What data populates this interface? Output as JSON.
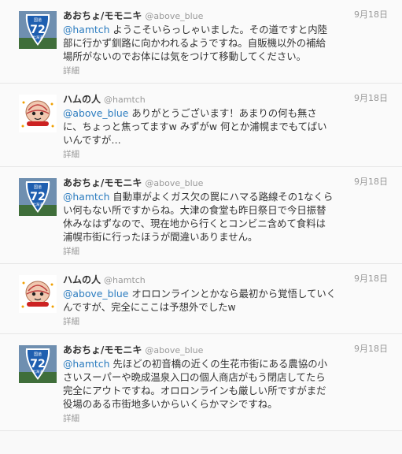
{
  "tweets": [
    {
      "avatar": "route-72-sign",
      "name": "あおちょ/モモニキ",
      "handle": "@above_blue",
      "time": "9月18日",
      "mention": "@hamtch",
      "lines": [
        "ようこそいらっしゃいました。その道ですと内陸",
        "部に行かず釧路に向かわれるようですね。自販機以外の補給",
        "場所がないのでお体には気をつけて移動してください。"
      ],
      "details": "詳細"
    },
    {
      "avatar": "ham-character",
      "name": "ハムの人",
      "handle": "@hamtch",
      "time": "9月18日",
      "mention": "@above_blue",
      "lines": [
        "ありがとうございます！あまりの何も無さ",
        "に、ちょっと焦ってますw みずがw 何とか浦幌までもてばい",
        "いんですが…"
      ],
      "details": "詳細"
    },
    {
      "avatar": "route-72-sign",
      "name": "あおちょ/モモニキ",
      "handle": "@above_blue",
      "time": "9月18日",
      "mention": "@hamtch",
      "lines": [
        "自動車がよくガス欠の罠にハマる路線その1なくら",
        "い何もない所ですからね。大津の食堂も昨日祭日で今日振替",
        "休みなはずなので、現在地から行くとコンビニ含めて食料は",
        "浦幌市街に行ったほうが間違いありません。"
      ],
      "details": "詳細"
    },
    {
      "avatar": "ham-character",
      "name": "ハムの人",
      "handle": "@hamtch",
      "time": "9月18日",
      "mention": "@above_blue",
      "lines": [
        "オロロンラインとかなら最初から覚悟していく",
        "んですが、完全にここは予想外でしたw"
      ],
      "details": "詳細"
    },
    {
      "avatar": "route-72-sign",
      "name": "あおちょ/モモニキ",
      "handle": "@above_blue",
      "time": "9月18日",
      "mention": "@hamtch",
      "lines": [
        "先ほどの初音橋の近くの生花市街にある農協の小",
        "さいスーパーや晩成温泉入口の個人商店がもう閉店してたら",
        "完全にアウトですね。オロロンラインも厳しい所ですがまだ",
        "役場のある市街地多いからいくらかマシですね。"
      ],
      "details": "詳細"
    }
  ],
  "route_sign": {
    "top": "国道",
    "number": "72",
    "bottom": "北海道"
  },
  "colors": {
    "link": "#2a7bbf",
    "meta": "#999999",
    "sign_blue": "#1f5fb0"
  }
}
